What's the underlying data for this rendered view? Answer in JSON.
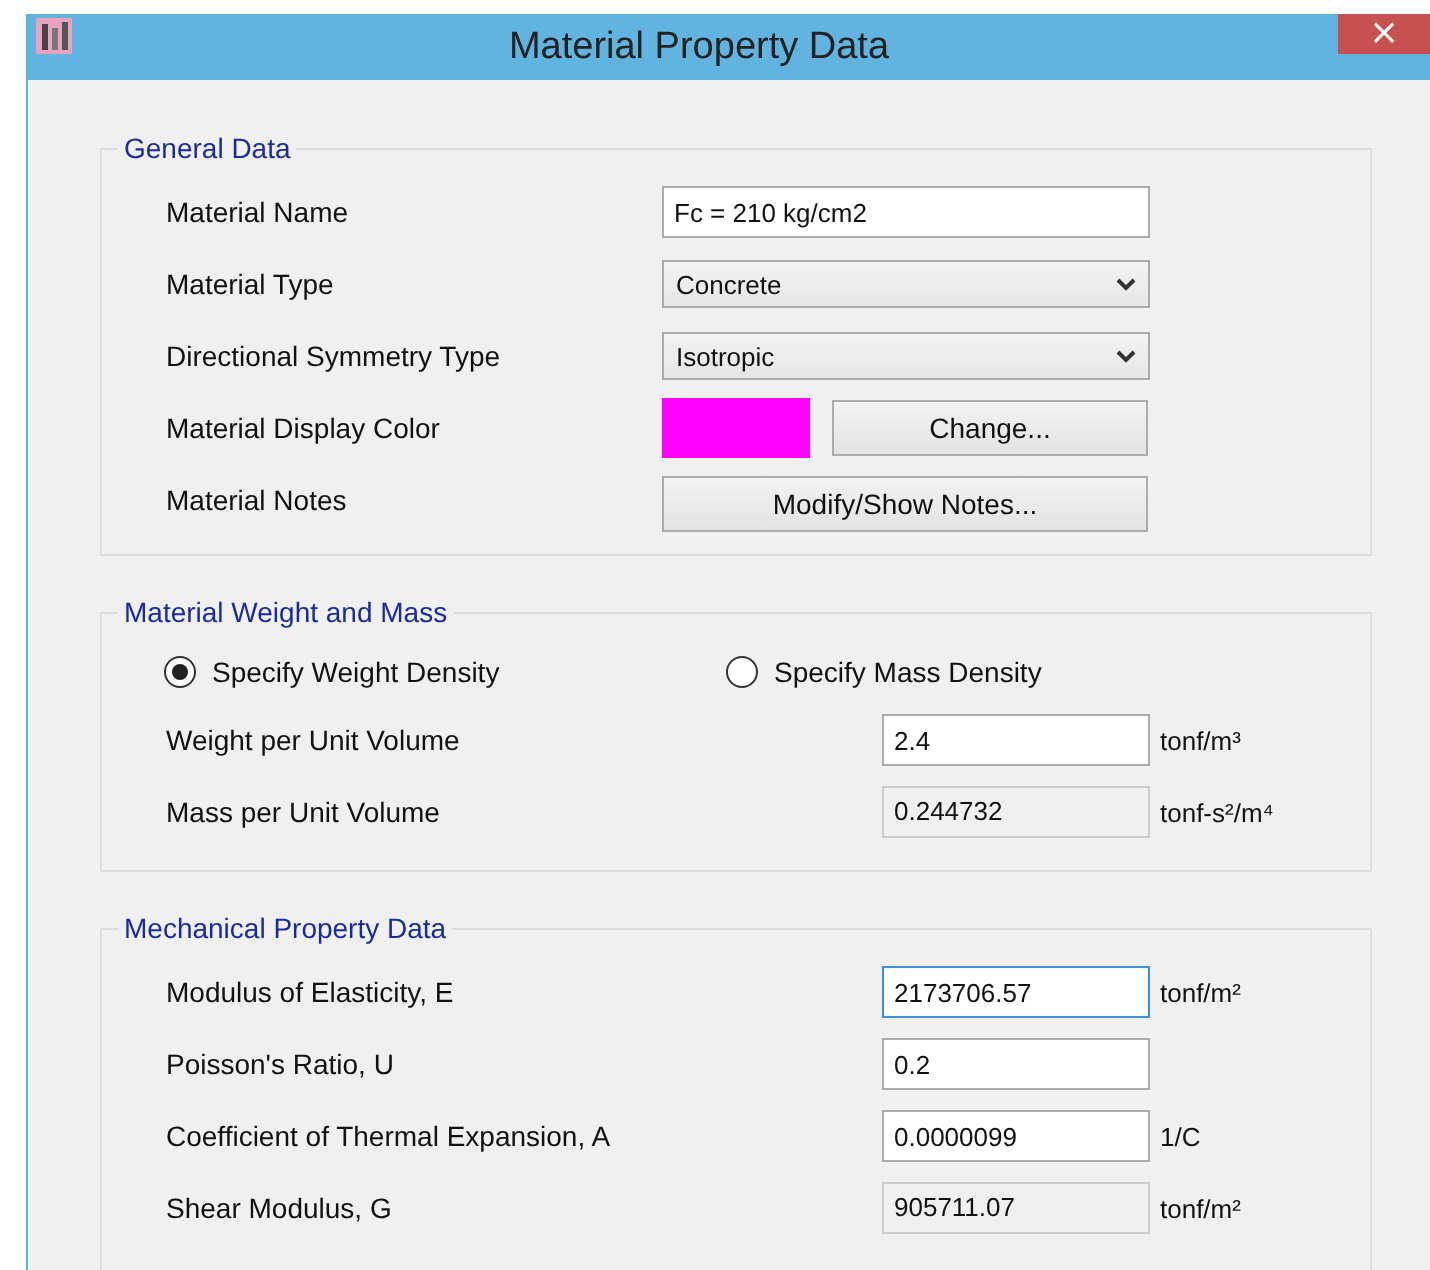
{
  "window": {
    "title": "Material Property Data",
    "close": "×"
  },
  "general": {
    "title": "General Data",
    "rows": [
      {
        "label": "Material Name",
        "kind": "text",
        "value": "Fc = 210 kg/cm2"
      },
      {
        "label": "Material Type",
        "kind": "dropdown",
        "value": "Concrete"
      },
      {
        "label": "Directional Symmetry Type",
        "kind": "dropdown",
        "value": "Isotropic"
      },
      {
        "label": "Material Display Color",
        "kind": "color",
        "color": "#ff00ff",
        "button": "Change..."
      },
      {
        "label": "Material Notes",
        "kind": "button",
        "button": "Modify/Show Notes..."
      }
    ]
  },
  "weight": {
    "title": "Material Weight and Mass",
    "options": [
      {
        "label": "Specify Weight Density",
        "selected": true
      },
      {
        "label": "Specify Mass Density",
        "selected": false
      }
    ],
    "rows": [
      {
        "label": "Weight per Unit Volume",
        "value": "2.4",
        "unit": "tonf/m³",
        "disabled": false,
        "focused": false
      },
      {
        "label": "Mass per Unit Volume",
        "value": "0.244732",
        "unit": "tonf-s²/m⁴",
        "disabled": true,
        "focused": false
      }
    ]
  },
  "mechanical": {
    "title": "Mechanical Property Data",
    "rows": [
      {
        "label": "Modulus of Elasticity,  E",
        "value": "2173706.57",
        "unit": "tonf/m²",
        "disabled": false,
        "focused": true
      },
      {
        "label": "Poisson's Ratio,  U",
        "value": "0.2",
        "disabled": false,
        "focused": false
      },
      {
        "label": "Coefficient of Thermal Expansion,  A",
        "value": "0.0000099",
        "unit": "1/C",
        "disabled": false,
        "focused": false
      },
      {
        "label": "Shear Modulus,  G",
        "value": "905711.07",
        "unit": "tonf/m²",
        "disabled": true,
        "focused": false
      }
    ]
  }
}
